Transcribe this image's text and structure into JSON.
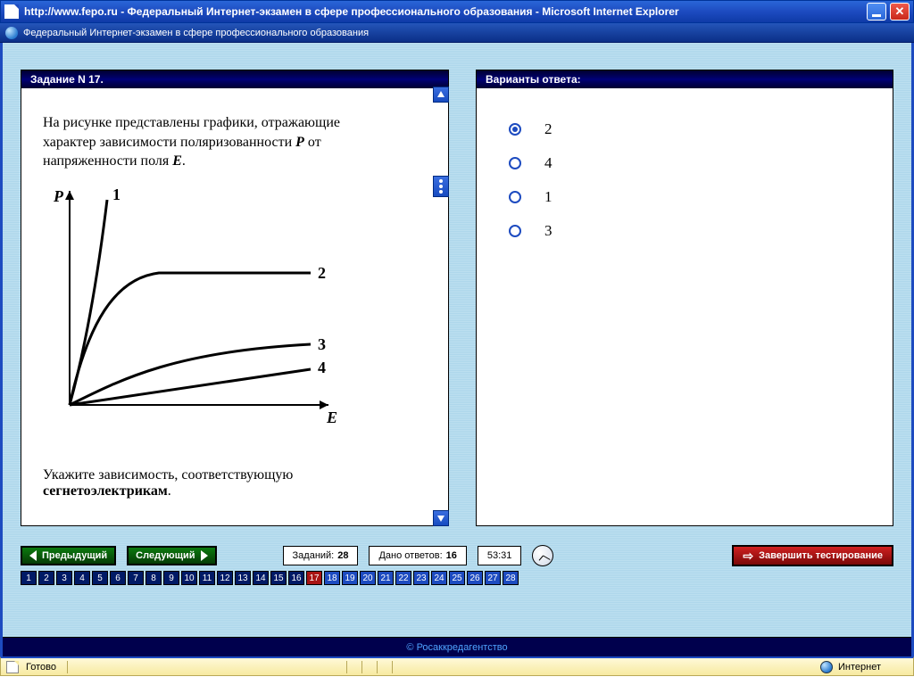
{
  "window": {
    "title": "http://www.fepo.ru - Федеральный Интернет-экзамен в сфере профессионального образования - Microsoft Internet Explorer",
    "tab": "Федеральный Интернет-экзамен в сфере профессионального образования"
  },
  "task": {
    "header": "Задание N 17.",
    "text_line1": "На рисунке представлены графики, отражающие",
    "text_line2": "характер зависимости поляризованности ",
    "var_P": "P",
    "text_line2b": " от",
    "text_line3": "напряженности поля ",
    "var_E": "E",
    "period": ".",
    "bottom1": "Укажите зависимость, соответствующую ",
    "bottom_bold": "сегнетоэлектрикам",
    "axis_y": "P",
    "axis_x": "E",
    "curve_labels": {
      "c1": "1",
      "c2": "2",
      "c3": "3",
      "c4": "4"
    }
  },
  "answers": {
    "header": "Варианты ответа:",
    "options": [
      {
        "label": "2",
        "selected": true
      },
      {
        "label": "4",
        "selected": false
      },
      {
        "label": "1",
        "selected": false
      },
      {
        "label": "3",
        "selected": false
      }
    ]
  },
  "nav": {
    "prev": "Предыдущий",
    "next": "Следующий",
    "total_tasks_label": "Заданий:",
    "total_tasks": "28",
    "answered_label": "Дано ответов:",
    "answered": "16",
    "timer": "53:31",
    "finish": "Завершить тестирование"
  },
  "strip": {
    "count": 28,
    "current": 17,
    "answered_upto": 16
  },
  "footer": {
    "credit": "© Росаккредагентство"
  },
  "status": {
    "ready": "Готово",
    "zone": "Интернет"
  },
  "chart_data": {
    "type": "line",
    "title": "",
    "xlabel": "E",
    "ylabel": "P",
    "xlim": [
      0,
      10
    ],
    "ylim": [
      0,
      10
    ],
    "series": [
      {
        "name": "1",
        "x": [
          0,
          0.3,
          0.6,
          0.9,
          1.2,
          1.5,
          1.8
        ],
        "y": [
          0,
          1.3,
          2.8,
          4.5,
          6.4,
          8.2,
          9.8
        ]
      },
      {
        "name": "2",
        "x": [
          0,
          0.4,
          0.8,
          1.2,
          1.8,
          3,
          5,
          7,
          9.5
        ],
        "y": [
          0,
          2.0,
          3.8,
          5.0,
          5.6,
          5.85,
          5.9,
          5.9,
          5.9
        ]
      },
      {
        "name": "3",
        "x": [
          0,
          1,
          2,
          3.5,
          5,
          7,
          9.5
        ],
        "y": [
          0,
          0.9,
          1.6,
          2.2,
          2.55,
          2.7,
          2.75
        ]
      },
      {
        "name": "4",
        "x": [
          0,
          9.5
        ],
        "y": [
          0,
          1.6
        ]
      }
    ]
  }
}
